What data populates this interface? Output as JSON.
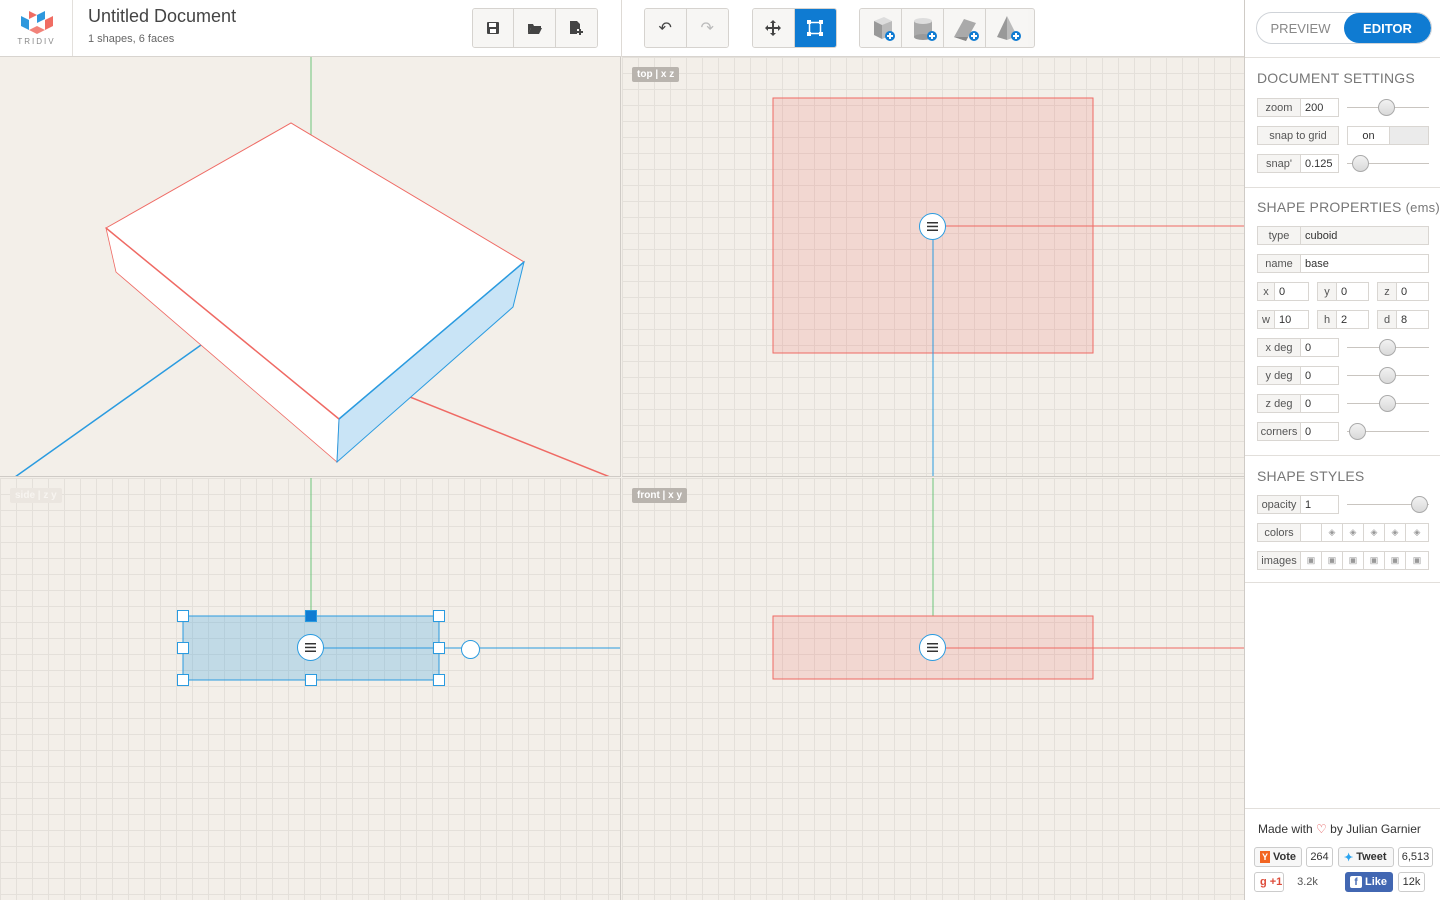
{
  "app": {
    "logo_text": "TRIDIV"
  },
  "document": {
    "title": "Untitled Document",
    "summary": "1 shapes, 6 faces"
  },
  "toolbar": {
    "file": [
      {
        "name": "save",
        "icon": "save-icon"
      },
      {
        "name": "open",
        "icon": "folder-open-icon"
      },
      {
        "name": "new",
        "icon": "new-file-icon"
      }
    ],
    "history": [
      {
        "name": "undo",
        "icon": "undo-icon"
      },
      {
        "name": "redo",
        "icon": "redo-icon"
      }
    ],
    "tools": [
      {
        "name": "move",
        "icon": "move-arrows-icon"
      },
      {
        "name": "select",
        "icon": "selection-box-icon",
        "active": true
      }
    ],
    "add_shapes": [
      {
        "name": "add-cuboid",
        "icon": "cube-plus-icon"
      },
      {
        "name": "add-cylinder",
        "icon": "cylinder-plus-icon"
      },
      {
        "name": "add-prism",
        "icon": "prism-plus-icon"
      },
      {
        "name": "add-pyramid",
        "icon": "pyramid-plus-icon"
      }
    ]
  },
  "viewports": {
    "top": "top | x z",
    "side": "side | z y",
    "front": "front | x y"
  },
  "mode": {
    "preview": "PREVIEW",
    "editor": "EDITOR",
    "active": "editor"
  },
  "document_settings": {
    "title": "DOCUMENT SETTINGS",
    "zoom_label": "zoom",
    "zoom": "200",
    "snap_label": "snap to grid",
    "snap": "on",
    "snap_step_label": "snap'",
    "snap_step": "0.125"
  },
  "shape_properties": {
    "title": "SHAPE PROPERTIES",
    "unit": "(ems)",
    "type_label": "type",
    "type": "cuboid",
    "name_label": "name",
    "name": "base",
    "x_label": "x",
    "x": "0",
    "y_label": "y",
    "y": "0",
    "z_label": "z",
    "z": "0",
    "w_label": "w",
    "w": "10",
    "h_label": "h",
    "h": "2",
    "d_label": "d",
    "d": "8",
    "xdeg_label": "x deg",
    "xdeg": "0",
    "ydeg_label": "y deg",
    "ydeg": "0",
    "zdeg_label": "z deg",
    "zdeg": "0",
    "corners_label": "corners",
    "corners": "0"
  },
  "shape_styles": {
    "title": "SHAPE STYLES",
    "opacity_label": "opacity",
    "opacity": "1",
    "colors_label": "colors",
    "images_label": "images"
  },
  "credits": {
    "made_with": "Made with",
    "by": "by Julian Garnier",
    "vote": "Vote",
    "vote_count": "264",
    "tweet": "Tweet",
    "tweet_count": "6,513",
    "gplus": "+1",
    "gplus_count": "3.2k",
    "like": "Like",
    "like_count": "12k"
  },
  "colors": {
    "accent": "#0f7bd2",
    "red_axis": "#ef6a64",
    "blue_axis": "#2a9be0",
    "green_axis": "#6cc47a"
  }
}
